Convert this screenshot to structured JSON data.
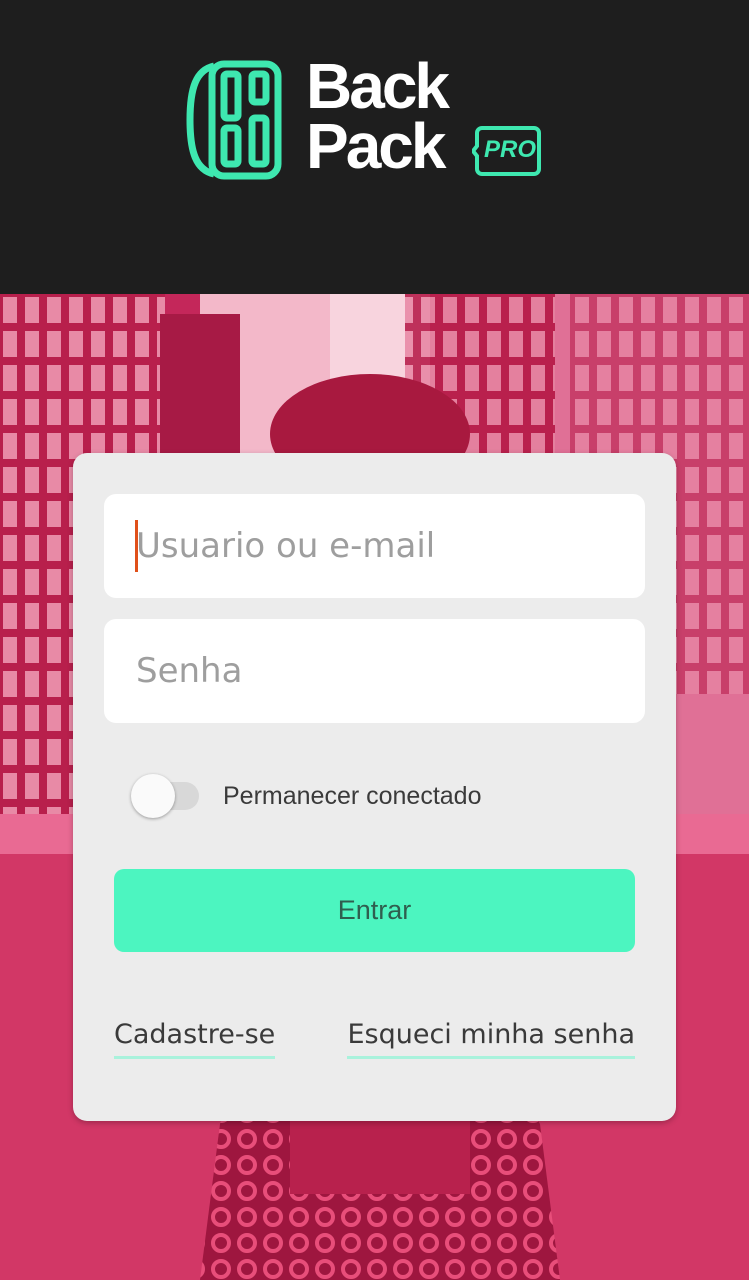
{
  "brand": {
    "line1": "Back",
    "line2": "Pack",
    "badge": "PRO",
    "accent_color": "#3ee8b0",
    "header_bg": "#1e1e1e"
  },
  "hero": {
    "tint_color": "#c52a5a"
  },
  "login": {
    "username_placeholder": "Usuario ou e-mail",
    "password_placeholder": "Senha",
    "remember_label": "Permanecer conectado",
    "remember_checked": false,
    "submit_label": "Entrar",
    "submit_color": "#4cf5c0",
    "signup_link": "Cadastre-se",
    "forgot_link": "Esqueci minha senha"
  }
}
